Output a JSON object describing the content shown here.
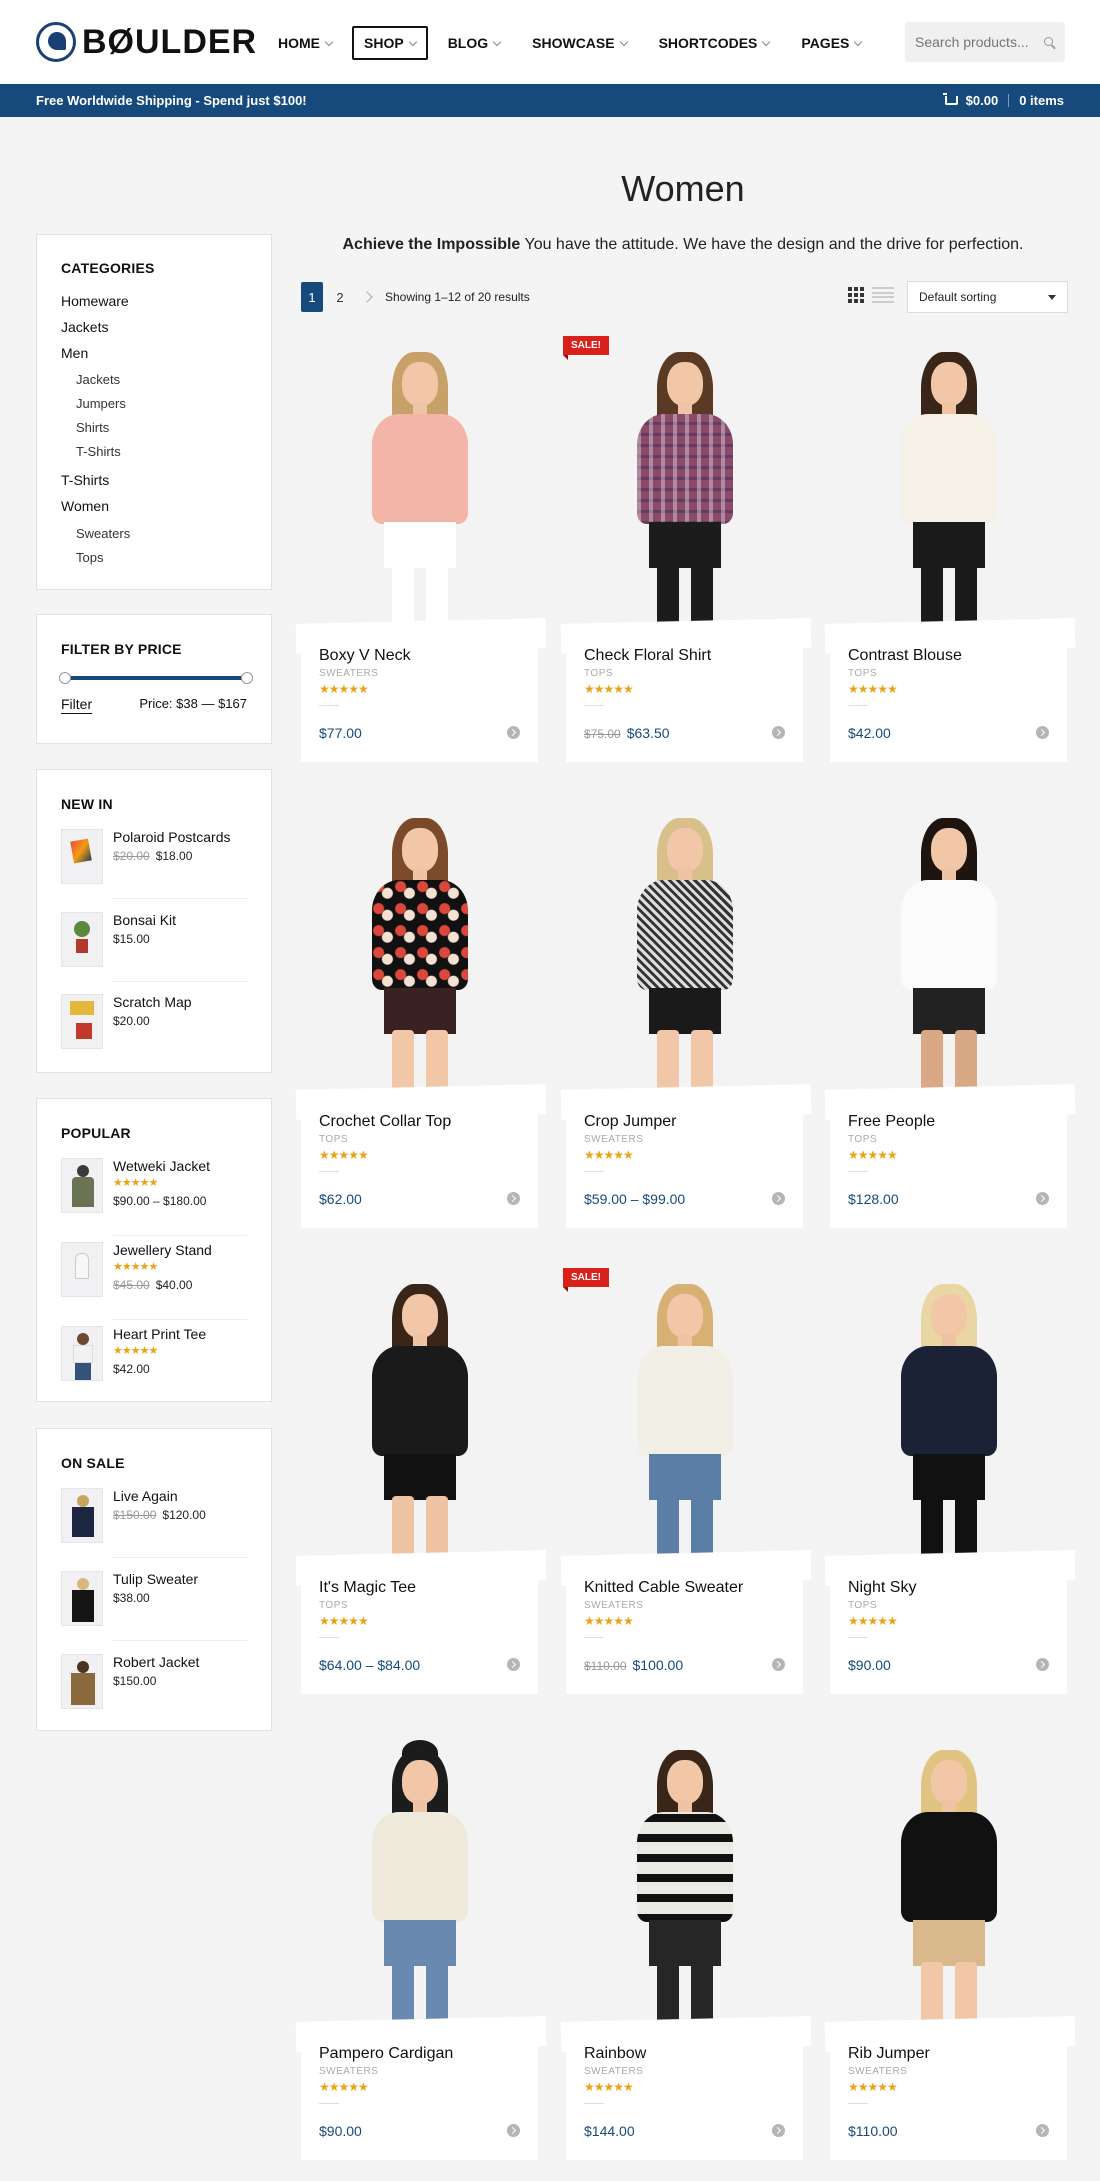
{
  "header": {
    "logo": "BØULDER",
    "nav": [
      {
        "label": "HOME",
        "active": false
      },
      {
        "label": "SHOP",
        "active": true
      },
      {
        "label": "BLOG",
        "active": false
      },
      {
        "label": "SHOWCASE",
        "active": false
      },
      {
        "label": "SHORTCODES",
        "active": false
      },
      {
        "label": "PAGES",
        "active": false
      }
    ],
    "search_placeholder": "Search products..."
  },
  "topbar": {
    "promo": "Free Worldwide Shipping - Spend just $100!",
    "cart_total": "$0.00",
    "cart_items": "0 items"
  },
  "page": {
    "title": "Women",
    "desc_bold": "Achieve the Impossible",
    "desc_rest": " You have the attitude. We have the design and the drive for perfection."
  },
  "sidebar": {
    "categories_title": "CATEGORIES",
    "categories": [
      {
        "label": "Homeware",
        "sub": false
      },
      {
        "label": "Jackets",
        "sub": false
      },
      {
        "label": "Men",
        "sub": false
      },
      {
        "label": "Jackets",
        "sub": true
      },
      {
        "label": "Jumpers",
        "sub": true
      },
      {
        "label": "Shirts",
        "sub": true
      },
      {
        "label": "T-Shirts",
        "sub": true
      },
      {
        "label": "T-Shirts",
        "sub": false
      },
      {
        "label": "Women",
        "sub": false
      },
      {
        "label": "Sweaters",
        "sub": true
      },
      {
        "label": "Tops",
        "sub": true
      }
    ],
    "filter_title": "FILTER BY PRICE",
    "filter_button": "Filter",
    "price_range": "Price: $38 — $167",
    "new_in_title": "NEW IN",
    "new_in": [
      {
        "name": "Polaroid Postcards",
        "old": "$20.00",
        "price": "$18.00"
      },
      {
        "name": "Bonsai Kit",
        "old": "",
        "price": "$15.00"
      },
      {
        "name": "Scratch Map",
        "old": "",
        "price": "$20.00"
      }
    ],
    "popular_title": "POPULAR",
    "popular": [
      {
        "name": "Wetweki Jacket",
        "old": "",
        "price": "$90.00 – $180.00"
      },
      {
        "name": "Jewellery Stand",
        "old": "$45.00",
        "price": "$40.00"
      },
      {
        "name": "Heart Print Tee",
        "old": "",
        "price": "$42.00"
      }
    ],
    "on_sale_title": "ON SALE",
    "on_sale": [
      {
        "name": "Live Again",
        "old": "$150.00",
        "price": "$120.00"
      },
      {
        "name": "Tulip Sweater",
        "old": "",
        "price": "$38.00"
      },
      {
        "name": "Robert Jacket",
        "old": "",
        "price": "$150.00"
      }
    ]
  },
  "toolbar": {
    "pages": [
      "1",
      "2"
    ],
    "results": "Showing 1–12 of 20 results",
    "sorting": "Default sorting"
  },
  "products": [
    {
      "name": "Boxy V Neck",
      "cat": "SWEATERS",
      "old": "",
      "price": "$77.00",
      "sale": false,
      "stars": "★★★★★"
    },
    {
      "name": "Check Floral Shirt",
      "cat": "TOPS",
      "old": "$75.00",
      "price": "$63.50",
      "sale": true,
      "stars": "★★★★★"
    },
    {
      "name": "Contrast Blouse",
      "cat": "TOPS",
      "old": "",
      "price": "$42.00",
      "sale": false,
      "stars": "★★★★★"
    },
    {
      "name": "Crochet Collar Top",
      "cat": "TOPS",
      "old": "",
      "price": "$62.00",
      "sale": false,
      "stars": "★★★★★"
    },
    {
      "name": "Crop Jumper",
      "cat": "SWEATERS",
      "old": "",
      "price": "$59.00 – $99.00",
      "sale": false,
      "stars": "★★★★★"
    },
    {
      "name": "Free People",
      "cat": "TOPS",
      "old": "",
      "price": "$128.00",
      "sale": false,
      "stars": "★★★★★"
    },
    {
      "name": "It's Magic Tee",
      "cat": "TOPS",
      "old": "",
      "price": "$64.00 – $84.00",
      "sale": false,
      "stars": "★★★★★"
    },
    {
      "name": "Knitted Cable Sweater",
      "cat": "SWEATERS",
      "old": "$110.00",
      "price": "$100.00",
      "sale": true,
      "stars": "★★★★★"
    },
    {
      "name": "Night Sky",
      "cat": "TOPS",
      "old": "",
      "price": "$90.00",
      "sale": false,
      "stars": "★★★★★"
    },
    {
      "name": "Pampero Cardigan",
      "cat": "SWEATERS",
      "old": "",
      "price": "$90.00",
      "sale": false,
      "stars": "★★★★★"
    },
    {
      "name": "Rainbow",
      "cat": "SWEATERS",
      "old": "",
      "price": "$144.00",
      "sale": false,
      "stars": "★★★★★"
    },
    {
      "name": "Rib Jumper",
      "cat": "SWEATERS",
      "old": "",
      "price": "$110.00",
      "sale": false,
      "stars": "★★★★★"
    }
  ],
  "sale_label": "SALE!",
  "colors": {
    "brand": "#174a7c",
    "sale": "#d9211b",
    "stars": "#e8a317"
  }
}
